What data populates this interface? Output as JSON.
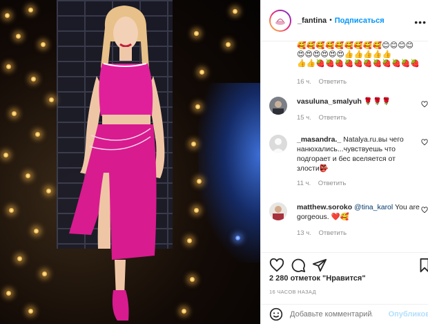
{
  "header": {
    "username": "_fantina",
    "separator": "•",
    "follow_label": "Подписаться",
    "more_icon": "ellipsis-icon"
  },
  "comments": {
    "emoji_lines": [
      "🥰🥰🥰🥰🥰🥰🥰🥰🥰😊😊😊😊",
      "😍😍😍😍😍😍👍👍👍👍👍",
      "👍👍🍓🍓🍓🍓🍓🍓🍓🍓🍓🍓🍓"
    ],
    "emoji_meta": {
      "time": "16 ч.",
      "reply": "Ответить"
    },
    "items": [
      {
        "username": "vasuluna_smalyuh",
        "text": "🌹🌹🌹",
        "time": "15 ч.",
        "reply": "Ответить"
      },
      {
        "username": "_masandra._",
        "text": "Natalya.ru.вы чего нанюхались...чувствуешь что подгорает и бес вселяется от злости👺",
        "time": "11 ч.",
        "reply": "Ответить"
      },
      {
        "username": "matthew.soroko",
        "mention": "@tina_karol",
        "text": "You are gorgeous. ❤️🥰",
        "time": "13 ч.",
        "reply": "Ответить"
      }
    ]
  },
  "actions": {
    "like_icon": "heart-icon",
    "comment_icon": "comment-icon",
    "share_icon": "send-icon",
    "save_icon": "bookmark-icon"
  },
  "likes_text": "2 280 отметок \"Нравится\"",
  "posted_time": "16 ЧАСОВ НАЗАД",
  "add_comment": {
    "placeholder": "Добавьте комментарий...",
    "publish_label": "Опубликова",
    "emoji_icon": "smiley-icon"
  },
  "colors": {
    "accent": "#0095f6",
    "publish_disabled": "#b2dffc",
    "muted": "#8e8e8e",
    "heart_red": "#ed4956",
    "dress_pink": "#e0209a"
  }
}
